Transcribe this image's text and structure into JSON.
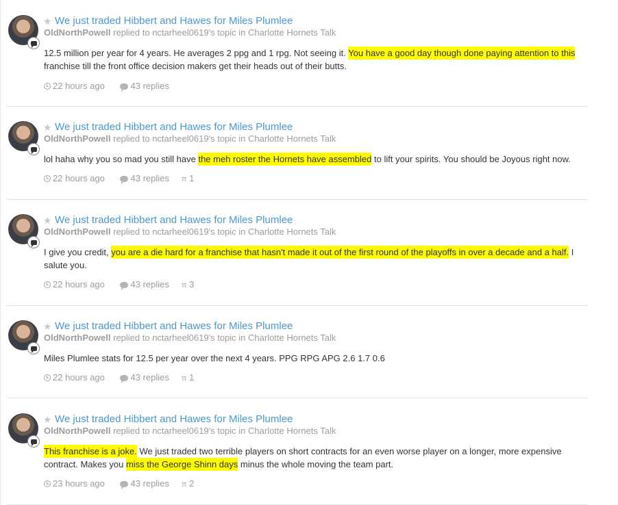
{
  "posts": [
    {
      "title": "We just traded Hibbert and Hawes for Miles Plumlee",
      "author": "OldNorthPowell",
      "replied_to": " replied to ",
      "topic_owner": "nctarheel0619's",
      "topic_word": " topic in ",
      "forum": "Charlotte Hornets Talk",
      "body": [
        {
          "text": "12.5 million per year for 4 years. He averages 2 ppg and 1 rpg. Not seeing it. ",
          "hl": false
        },
        {
          "text": "You have a good day though done paying attention to this",
          "hl": true
        },
        {
          "text": " franchise till the front office decision makers get their heads out of their butts.",
          "hl": false
        }
      ],
      "time": "22 hours ago",
      "replies": "43 replies",
      "reputation": ""
    },
    {
      "title": "We just traded Hibbert and Hawes for Miles Plumlee",
      "author": "OldNorthPowell",
      "replied_to": " replied to ",
      "topic_owner": "nctarheel0619's",
      "topic_word": " topic in ",
      "forum": "Charlotte Hornets Talk",
      "body": [
        {
          "text": "lol haha why you so mad you still have ",
          "hl": false
        },
        {
          "text": "the meh roster the Hornets have assembled",
          "hl": true
        },
        {
          "text": " to lift your spirits. You should be Joyous right now.",
          "hl": false
        }
      ],
      "time": "22 hours ago",
      "replies": "43 replies",
      "reputation": "1"
    },
    {
      "title": "We just traded Hibbert and Hawes for Miles Plumlee",
      "author": "OldNorthPowell",
      "replied_to": " replied to ",
      "topic_owner": "nctarheel0619's",
      "topic_word": " topic in ",
      "forum": "Charlotte Hornets Talk",
      "body": [
        {
          "text": "I give you credit, ",
          "hl": false
        },
        {
          "text": "you are a die hard for a franchise that hasn't made it out of the first round of the playoffs in over a decade and a half.",
          "hl": true
        },
        {
          "text": " I salute you.",
          "hl": false
        }
      ],
      "time": "22 hours ago",
      "replies": "43 replies",
      "reputation": "3"
    },
    {
      "title": "We just traded Hibbert and Hawes for Miles Plumlee",
      "author": "OldNorthPowell",
      "replied_to": " replied to ",
      "topic_owner": "nctarheel0619's",
      "topic_word": " topic in ",
      "forum": "Charlotte Hornets Talk",
      "body": [
        {
          "text": "Miles Plumlee stats for 12.5 per year over the next 4 years. PPG RPG APG 2.6 1.7 0.6",
          "hl": false
        }
      ],
      "time": "22 hours ago",
      "replies": "43 replies",
      "reputation": "1"
    },
    {
      "title": "We just traded Hibbert and Hawes for Miles Plumlee",
      "author": "OldNorthPowell",
      "replied_to": " replied to ",
      "topic_owner": "nctarheel0619's",
      "topic_word": " topic in ",
      "forum": "Charlotte Hornets Talk",
      "body": [
        {
          "text": "This franchise is a joke.",
          "hl": true
        },
        {
          "text": " We just traded two terrible players on short contracts for an even worse player on a longer, more expensive contract. Makes you ",
          "hl": false
        },
        {
          "text": "miss the George Shinn days",
          "hl": true
        },
        {
          "text": " minus the whole moving the team part.",
          "hl": false
        }
      ],
      "time": "23 hours ago",
      "replies": "43 replies",
      "reputation": "2"
    }
  ],
  "icons": {
    "star": "star-icon",
    "badge": "comment-badge-icon",
    "clock": "clock-icon",
    "replies": "speech-bubble-icon",
    "reputation": "reputation-icon"
  },
  "colors": {
    "link": "#4a98cf",
    "muted": "#9c9c9c",
    "highlight": "#fffb00"
  }
}
